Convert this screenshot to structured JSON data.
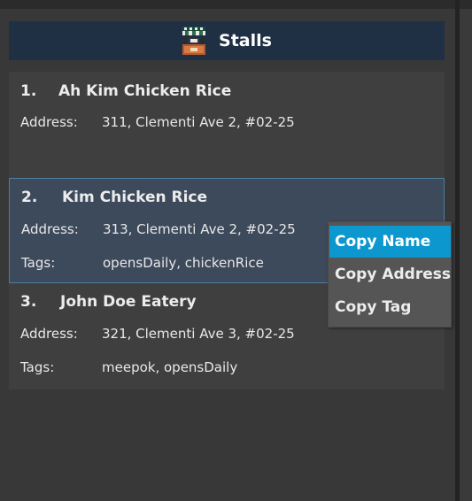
{
  "panel": {
    "title": "Stalls",
    "icon": "stall-icon"
  },
  "stalls": [
    {
      "index": "1.",
      "name": "Ah Kim Chicken Rice",
      "address_label": "Address:",
      "address": "311, Clementi Ave 2, #02-25",
      "tags_label": "",
      "tags": ""
    },
    {
      "index": "2.",
      "name": "Kim Chicken Rice",
      "address_label": "Address:",
      "address": "313, Clementi Ave 2, #02-25",
      "tags_label": "Tags:",
      "tags": "opensDaily, chickenRice",
      "selected": true
    },
    {
      "index": "3.",
      "name": "John Doe Eatery",
      "address_label": "Address:",
      "address": "321, Clementi Ave 3, #02-25",
      "tags_label": "Tags:",
      "tags": "meepok, opensDaily"
    }
  ],
  "context_menu": {
    "items": [
      {
        "label": "Copy Name",
        "highlighted": true
      },
      {
        "label": "Copy Address",
        "highlighted": false
      },
      {
        "label": "Copy Tag",
        "highlighted": false
      }
    ]
  },
  "colors": {
    "background": "#383838",
    "header": "#1f2f44",
    "selected_card": "#3d4a5c",
    "selected_border": "#4e7e9e",
    "menu_highlight": "#0d97cf"
  }
}
